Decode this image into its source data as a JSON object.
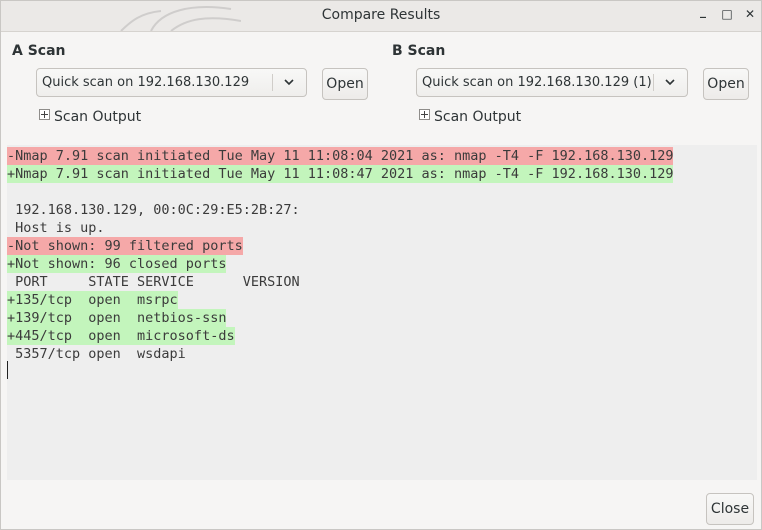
{
  "window": {
    "title": "Compare Results",
    "controls": {
      "minimize": "_",
      "maximize": "□",
      "close": "✕"
    }
  },
  "a_scan": {
    "label": "A Scan",
    "selected": "Quick scan on 192.168.130.129",
    "open_label": "Open",
    "expander_label": "Scan Output"
  },
  "b_scan": {
    "label": "B Scan",
    "selected": "Quick scan on 192.168.130.129 (1)",
    "open_label": "Open",
    "expander_label": "Scan Output"
  },
  "diff": {
    "lines": [
      {
        "type": "del",
        "text": "-Nmap 7.91 scan initiated Tue May 11 11:08:04 2021 as: nmap -T4 -F 192.168.130.129"
      },
      {
        "type": "ins",
        "text": "+Nmap 7.91 scan initiated Tue May 11 11:08:47 2021 as: nmap -T4 -F 192.168.130.129"
      },
      {
        "type": "ctx",
        "text": ""
      },
      {
        "type": "ctx",
        "text": " 192.168.130.129, 00:0C:29:E5:2B:27:"
      },
      {
        "type": "ctx",
        "text": " Host is up."
      },
      {
        "type": "del",
        "text": "-Not shown: 99 filtered ports"
      },
      {
        "type": "ins",
        "text": "+Not shown: 96 closed ports"
      },
      {
        "type": "ctx",
        "text": " PORT     STATE SERVICE      VERSION"
      },
      {
        "type": "ins",
        "text": "+135/tcp  open  msrpc"
      },
      {
        "type": "ins",
        "text": "+139/tcp  open  netbios-ssn"
      },
      {
        "type": "ins",
        "text": "+445/tcp  open  microsoft-ds"
      },
      {
        "type": "ctx",
        "text": " 5357/tcp open  wsdapi"
      }
    ]
  },
  "footer": {
    "close_label": "Close"
  }
}
